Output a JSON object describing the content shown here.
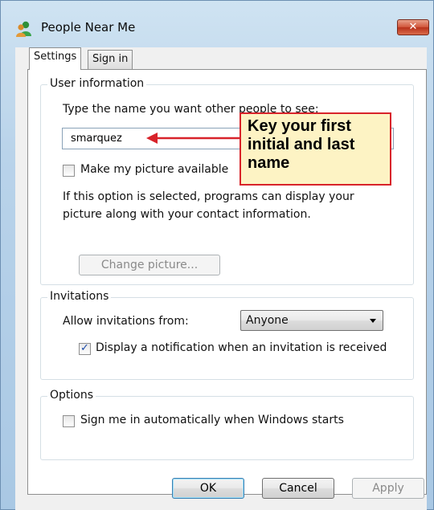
{
  "window": {
    "title": "People Near Me",
    "close_label": "✕"
  },
  "tabs": [
    {
      "label": "Settings"
    },
    {
      "label": "Sign in"
    }
  ],
  "user_info": {
    "legend": "User information",
    "name_prompt": "Type the name you want other people to see:",
    "name_value": "smarquez",
    "picture_checkbox_label": "Make my picture available",
    "picture_checked": false,
    "help_line1": "If this option is selected, programs can display your",
    "help_line2": "picture along with your contact information.",
    "change_picture_label": "Change picture..."
  },
  "invitations": {
    "legend": "Invitations",
    "allow_label": "Allow invitations from:",
    "allow_value": "Anyone",
    "notify_label": "Display a notification when an invitation is received",
    "notify_checked": true
  },
  "options": {
    "legend": "Options",
    "autosignin_label": "Sign me in automatically when Windows starts",
    "autosignin_checked": false
  },
  "buttons": {
    "ok": "OK",
    "cancel": "Cancel",
    "apply": "Apply"
  },
  "callout": {
    "line1": "Key your first",
    "line2": "initial and last",
    "line3": "name",
    "border_color": "#d8232a",
    "background": "#fdf3c4"
  },
  "icons": {
    "app": "people-icon"
  }
}
